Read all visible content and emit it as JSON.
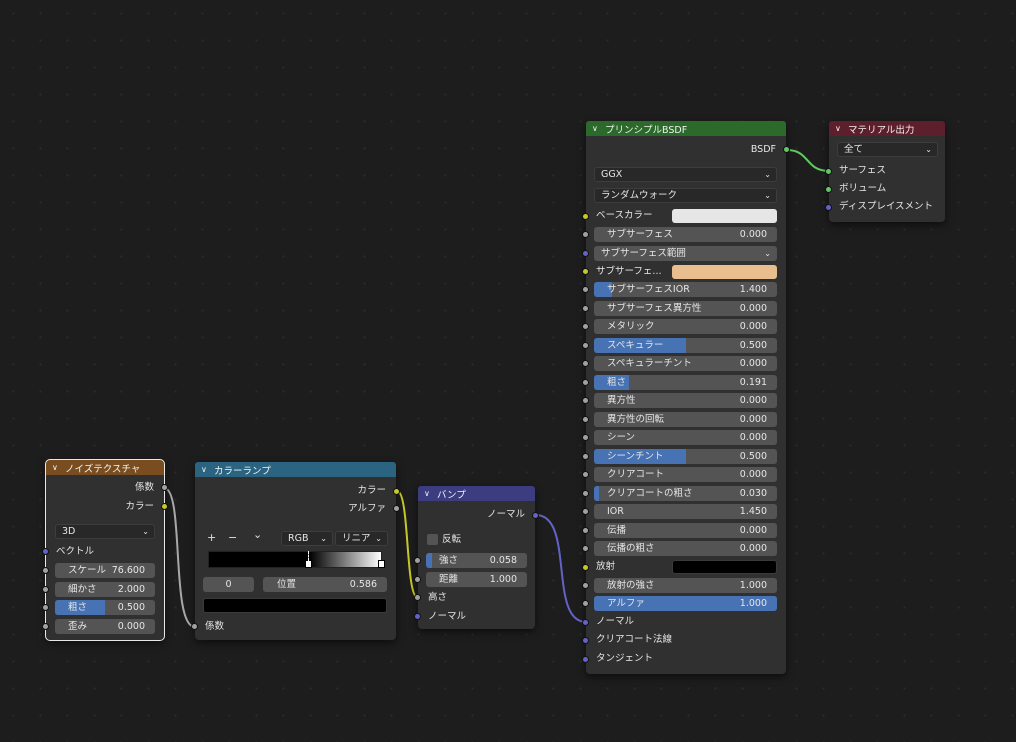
{
  "noise": {
    "title": "ノイズテクスチャ",
    "out_fac": "係数",
    "out_color": "カラー",
    "dimension": "3D",
    "in_vector": "ベクトル",
    "fields": [
      {
        "label": "スケール",
        "value": "76.600",
        "fill": 0
      },
      {
        "label": "細かさ",
        "value": "2.000",
        "fill": 0
      },
      {
        "label": "粗さ",
        "value": "0.500",
        "fill": 0.5
      },
      {
        "label": "歪み",
        "value": "0.000",
        "fill": 0
      }
    ]
  },
  "ramp": {
    "title": "カラーランプ",
    "out_color": "カラー",
    "out_alpha": "アルファ",
    "add": "+",
    "remove": "−",
    "menu": "⌄",
    "color_mode": "RGB",
    "interp": "リニア",
    "index": "0",
    "pos_label": "位置",
    "pos_value": "0.586",
    "in_fac": "係数"
  },
  "bump": {
    "title": "バンプ",
    "out_normal": "ノーマル",
    "invert": "反転",
    "fields": [
      {
        "label": "強さ",
        "value": "0.058",
        "fill": 0.058
      },
      {
        "label": "距離",
        "value": "1.000",
        "fill": 0
      }
    ],
    "in_height": "高さ",
    "in_normal": "ノーマル"
  },
  "bsdf": {
    "title": "プリンシプルBSDF",
    "out": "BSDF",
    "distribution": "GGX",
    "subsurface_method": "ランダムウォーク",
    "base_color_label": "ベースカラー",
    "base_color": "#e6e6e6",
    "subsurface_label": "サブサーフェス",
    "subsurface_value": "0.000",
    "subsurface_radius": "サブサーフェス範囲",
    "subsurface_color_label": "サブサーフェ...",
    "subsurface_color": "#e8be8f",
    "fields": [
      {
        "label": "サブサーフェスIOR",
        "value": "1.400",
        "fill": 0.1
      },
      {
        "label": "サブサーフェス異方性",
        "value": "0.000",
        "fill": 0
      },
      {
        "label": "メタリック",
        "value": "0.000",
        "fill": 0
      },
      {
        "label": "スペキュラー",
        "value": "0.500",
        "fill": 0.5
      },
      {
        "label": "スペキュラーチント",
        "value": "0.000",
        "fill": 0
      },
      {
        "label": "粗さ",
        "value": "0.191",
        "fill": 0.191
      },
      {
        "label": "異方性",
        "value": "0.000",
        "fill": 0
      },
      {
        "label": "異方性の回転",
        "value": "0.000",
        "fill": 0
      },
      {
        "label": "シーン",
        "value": "0.000",
        "fill": 0
      },
      {
        "label": "シーンチント",
        "value": "0.500",
        "fill": 0.5
      },
      {
        "label": "クリアコート",
        "value": "0.000",
        "fill": 0
      },
      {
        "label": "クリアコートの粗さ",
        "value": "0.030",
        "fill": 0.03
      },
      {
        "label": "IOR",
        "value": "1.450",
        "fill": 0
      },
      {
        "label": "伝播",
        "value": "0.000",
        "fill": 0
      },
      {
        "label": "伝播の粗さ",
        "value": "0.000",
        "fill": 0
      }
    ],
    "emission_label": "放射",
    "emission_color": "#000000",
    "emission_strength_label": "放射の強さ",
    "emission_strength_value": "1.000",
    "alpha_label": "アルファ",
    "alpha_value": "1.000",
    "normal": "ノーマル",
    "clearcoat_normal": "クリアコート法線",
    "tangent": "タンジェント"
  },
  "output": {
    "title": "マテリアル出力",
    "target": "全て",
    "surface": "サーフェス",
    "volume": "ボリューム",
    "displacement": "ディスプレイスメント"
  },
  "colors": {
    "texture_header": "#7a4d20",
    "converter_header": "#2b6480",
    "vector_header": "#3c3c80",
    "shader_header": "#2c6a2c",
    "output_header": "#5e1f2c",
    "field_fill": "#4772b3"
  }
}
